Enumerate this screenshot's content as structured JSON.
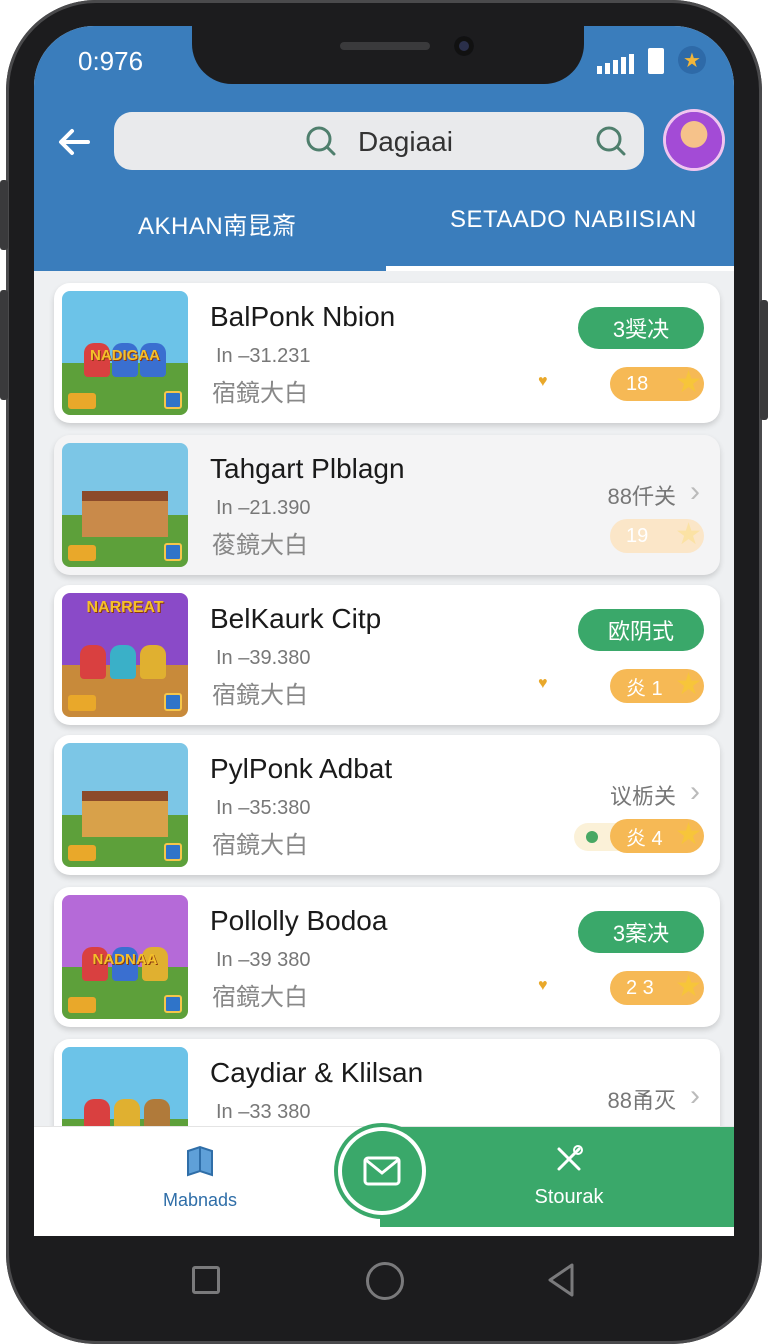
{
  "status_bar": {
    "time": "0:976",
    "signal_icon": "signal-icon",
    "battery_icon": "battery-icon",
    "badge_icon": "star-badge-icon"
  },
  "header": {
    "back_icon": "arrow-left-icon",
    "search": {
      "value": "Dagiaai",
      "icon": "search-icon"
    },
    "avatar": "avatar"
  },
  "tabs": [
    {
      "label": "AKHAN南昆斎",
      "active": false
    },
    {
      "label": "SETAADO NABIISIAN",
      "active": true
    }
  ],
  "items": [
    {
      "title": "BalPonk Nbion",
      "sub": "In –31.231",
      "sub2": "宿鏡大白",
      "action_type": "pill",
      "action_label": "3奨决",
      "rating": "18",
      "thumb_text": "NADIGAA"
    },
    {
      "title": "Tahgart Plblagn",
      "sub": "In –21.390",
      "sub2": "葰鏡大白",
      "action_type": "link",
      "action_label": "88仟关",
      "rating": "19",
      "thumb_text": ""
    },
    {
      "title": "BelKaurk Citp",
      "sub": "In –39.380",
      "sub2": "宿鏡大白",
      "action_type": "pill",
      "action_label": "欧阴式",
      "rating": "炎 1",
      "thumb_text": "NARREAT"
    },
    {
      "title": "PylPonk Adbat",
      "sub": "In –35:380",
      "sub2": "宿鏡大白",
      "action_type": "link",
      "action_label": "议栃关",
      "rating": "炎 4",
      "thumb_text": ""
    },
    {
      "title": "Pollolly Bodoa",
      "sub": "In –39 380",
      "sub2": "宿鏡大白",
      "action_type": "pill",
      "action_label": "3案决",
      "rating": "2 3",
      "thumb_text": "NADNAA"
    },
    {
      "title": "Caydiar & Klilsan",
      "sub": "In –33 380",
      "sub2": "",
      "action_type": "link",
      "action_label": "88甬灭",
      "rating": "",
      "thumb_text": ""
    }
  ],
  "bottom_nav": {
    "left": {
      "label": "Mabnads",
      "icon": "book-icon"
    },
    "center": {
      "icon": "mail-icon"
    },
    "right": {
      "label": "Stourak",
      "icon": "tools-icon"
    }
  },
  "colors": {
    "header_blue": "#3a7dbc",
    "green": "#3aa86a",
    "rating_orange": "#f6b955"
  }
}
